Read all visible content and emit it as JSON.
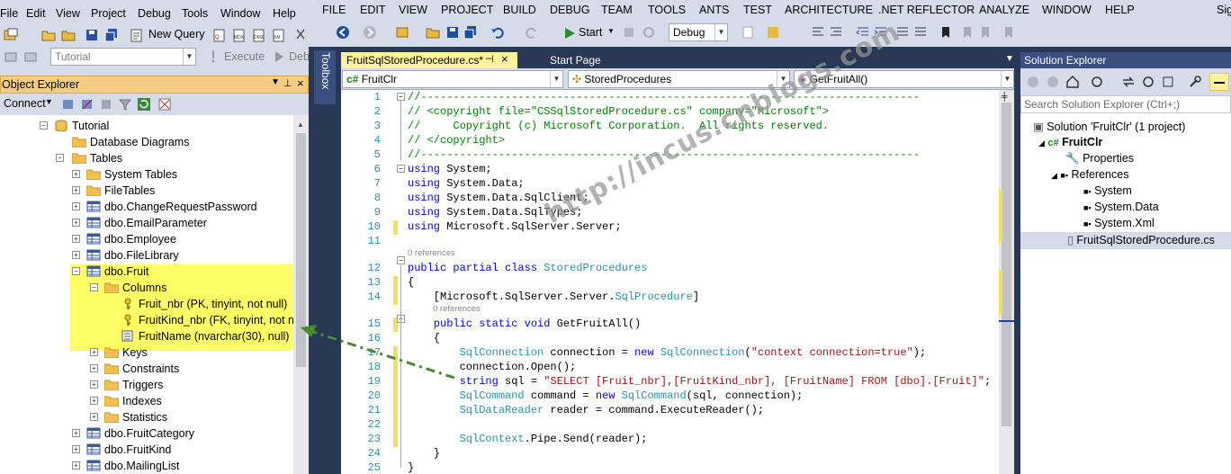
{
  "ssms": {
    "menu": [
      "File",
      "Edit",
      "View",
      "Project",
      "Debug",
      "Tools",
      "Window",
      "Help"
    ],
    "toolbar": {
      "new_query": "New Query"
    },
    "toolbar2": {
      "database_combo": "Tutorial",
      "execute": "Execute",
      "debug": "Debu"
    },
    "object_explorer": {
      "title": "Object Explorer",
      "connect": "Connect",
      "tree": [
        {
          "label": "Tutorial",
          "expander": "−",
          "icon": "database-icon"
        },
        {
          "label": "Database Diagrams",
          "expander": "",
          "icon": "folder-icon"
        },
        {
          "label": "Tables",
          "expander": "−",
          "icon": "folder-icon"
        },
        {
          "label": "System Tables",
          "expander": "+",
          "icon": "folder-icon"
        },
        {
          "label": "FileTables",
          "expander": "+",
          "icon": "folder-icon"
        },
        {
          "label": "dbo.ChangeRequestPassword",
          "expander": "+",
          "icon": "table-icon"
        },
        {
          "label": "dbo.EmailParameter",
          "expander": "+",
          "icon": "table-icon"
        },
        {
          "label": "dbo.Employee",
          "expander": "+",
          "icon": "table-icon"
        },
        {
          "label": "dbo.FileLibrary",
          "expander": "+",
          "icon": "table-icon"
        },
        {
          "label": "dbo.Fruit",
          "expander": "−",
          "icon": "table-icon"
        },
        {
          "label": "Columns",
          "expander": "−",
          "icon": "folder-icon"
        },
        {
          "label": "Fruit_nbr (PK, tinyint, not null)",
          "expander": "",
          "icon": "key-icon"
        },
        {
          "label": "FruitKind_nbr (FK, tinyint, not nu",
          "expander": "",
          "icon": "key-icon"
        },
        {
          "label": "FruitName (nvarchar(30), null)",
          "expander": "",
          "icon": "column-icon"
        },
        {
          "label": "Keys",
          "expander": "+",
          "icon": "folder-icon"
        },
        {
          "label": "Constraints",
          "expander": "+",
          "icon": "folder-icon"
        },
        {
          "label": "Triggers",
          "expander": "+",
          "icon": "folder-icon"
        },
        {
          "label": "Indexes",
          "expander": "+",
          "icon": "folder-icon"
        },
        {
          "label": "Statistics",
          "expander": "+",
          "icon": "folder-icon"
        },
        {
          "label": "dbo.FruitCategory",
          "expander": "+",
          "icon": "table-icon"
        },
        {
          "label": "dbo.FruitKind",
          "expander": "+",
          "icon": "table-icon"
        },
        {
          "label": "dbo.MailingList",
          "expander": "+",
          "icon": "table-icon"
        }
      ]
    }
  },
  "vs": {
    "menu": [
      "FILE",
      "EDIT",
      "VIEW",
      "PROJECT",
      "BUILD",
      "DEBUG",
      "TEAM",
      "TOOLS",
      "ANTS",
      "TEST",
      "ARCHITECTURE",
      ".NET REFLECTOR",
      "ANALYZE",
      "WINDOW",
      "HELP",
      "Sig"
    ],
    "toolbar": {
      "start": "Start",
      "config": "Debug"
    },
    "toolbox": "Toolbox",
    "tabs": [
      {
        "label": "FruitSqlStoredProcedure.cs*",
        "active": true
      },
      {
        "label": "Start Page",
        "active": false
      }
    ],
    "navbar": {
      "project": "FruitClr",
      "class": "StoredProcedures",
      "member": "GetFruitAll()"
    },
    "code_lines": [
      {
        "n": "1",
        "tokens": [
          {
            "c": "cm",
            "t": "//-----------------------------------------------------------------------------"
          }
        ]
      },
      {
        "n": "2",
        "tokens": [
          {
            "c": "cm",
            "t": "// <copyright file=\"CSSqlStoredProcedure.cs\" company=\"Microsoft\">"
          }
        ]
      },
      {
        "n": "3",
        "tokens": [
          {
            "c": "cm",
            "t": "//     Copyright (c) Microsoft Corporation.  All rights reserved."
          }
        ]
      },
      {
        "n": "4",
        "tokens": [
          {
            "c": "cm",
            "t": "// </copyright>"
          }
        ]
      },
      {
        "n": "5",
        "tokens": [
          {
            "c": "cm",
            "t": "//-----------------------------------------------------------------------------"
          }
        ]
      },
      {
        "n": "6",
        "tokens": [
          {
            "c": "kw",
            "t": "using"
          },
          {
            "c": "",
            "t": " System;"
          }
        ]
      },
      {
        "n": "7",
        "tokens": [
          {
            "c": "kw",
            "t": "using"
          },
          {
            "c": "",
            "t": " System.Data;"
          }
        ]
      },
      {
        "n": "8",
        "tokens": [
          {
            "c": "kw",
            "t": "using"
          },
          {
            "c": "",
            "t": " System.Data.SqlClient;"
          }
        ]
      },
      {
        "n": "9",
        "tokens": [
          {
            "c": "kw",
            "t": "using"
          },
          {
            "c": "",
            "t": " System.Data.SqlTypes;"
          }
        ]
      },
      {
        "n": "10",
        "tokens": [
          {
            "c": "kw",
            "t": "using"
          },
          {
            "c": "",
            "t": " Microsoft.SqlServer.Server;"
          }
        ]
      },
      {
        "n": "11",
        "tokens": []
      },
      {
        "n": "12",
        "tokens": [
          {
            "c": "kw",
            "t": "public partial class"
          },
          {
            "c": "",
            "t": " "
          },
          {
            "c": "tp",
            "t": "StoredProcedures"
          }
        ]
      },
      {
        "n": "13",
        "tokens": [
          {
            "c": "",
            "t": "{"
          }
        ]
      },
      {
        "n": "14",
        "tokens": [
          {
            "c": "",
            "t": "    [Microsoft.SqlServer.Server."
          },
          {
            "c": "tp",
            "t": "SqlProcedure"
          },
          {
            "c": "",
            "t": "]"
          }
        ]
      },
      {
        "n": "15",
        "tokens": [
          {
            "c": "kw",
            "t": "    public static void"
          },
          {
            "c": "",
            "t": " GetFruitAll()"
          }
        ]
      },
      {
        "n": "16",
        "tokens": [
          {
            "c": "",
            "t": "    {"
          }
        ]
      },
      {
        "n": "17",
        "tokens": [
          {
            "c": "tp",
            "t": "        SqlConnection"
          },
          {
            "c": "",
            "t": " connection = "
          },
          {
            "c": "kw",
            "t": "new"
          },
          {
            "c": "",
            "t": " "
          },
          {
            "c": "tp",
            "t": "SqlConnection"
          },
          {
            "c": "",
            "t": "("
          },
          {
            "c": "st",
            "t": "\"context connection=true\""
          },
          {
            "c": "",
            "t": ");"
          }
        ]
      },
      {
        "n": "18",
        "tokens": [
          {
            "c": "",
            "t": "        connection.Open();"
          }
        ]
      },
      {
        "n": "19",
        "tokens": [
          {
            "c": "kw",
            "t": "        string"
          },
          {
            "c": "",
            "t": " sql = "
          },
          {
            "c": "st",
            "t": "\"SELECT [Fruit_nbr],[FruitKind_nbr], [FruitName] FROM [dbo].[Fruit]\""
          },
          {
            "c": "",
            "t": ";"
          }
        ]
      },
      {
        "n": "20",
        "tokens": [
          {
            "c": "tp",
            "t": "        SqlCommand"
          },
          {
            "c": "",
            "t": " command = "
          },
          {
            "c": "kw",
            "t": "new"
          },
          {
            "c": "",
            "t": " "
          },
          {
            "c": "tp",
            "t": "SqlCommand"
          },
          {
            "c": "",
            "t": "(sql, connection);"
          }
        ]
      },
      {
        "n": "21",
        "tokens": [
          {
            "c": "tp",
            "t": "        SqlDataReader"
          },
          {
            "c": "",
            "t": " reader = command.ExecuteReader();"
          }
        ]
      },
      {
        "n": "22",
        "tokens": []
      },
      {
        "n": "23",
        "tokens": [
          {
            "c": "tp",
            "t": "        SqlContext"
          },
          {
            "c": "",
            "t": ".Pipe.Send(reader);"
          }
        ]
      },
      {
        "n": "24",
        "tokens": [
          {
            "c": "",
            "t": "    }"
          }
        ]
      },
      {
        "n": "25",
        "tokens": [
          {
            "c": "",
            "t": "}"
          }
        ]
      }
    ],
    "codelens": [
      "0 references",
      "0 references"
    ],
    "solution_explorer": {
      "title": "Solution Explorer",
      "search_placeholder": "Search Solution Explorer (Ctrl+;)",
      "items": [
        "Solution 'FruitClr' (1 project)",
        "FruitClr",
        "Properties",
        "References",
        "System",
        "System.Data",
        "System.Xml",
        "FruitSqlStoredProcedure.cs"
      ]
    }
  },
  "watermark": "http://incus.cnblogs.com",
  "colors": {
    "highlight": "#ffff66",
    "arrow": "#4a8c2a",
    "vs_frame": "#293955",
    "ssms_frame": "#d6dbe9",
    "active_tab": "#fff29d",
    "oe_title": "#f5cc84"
  }
}
